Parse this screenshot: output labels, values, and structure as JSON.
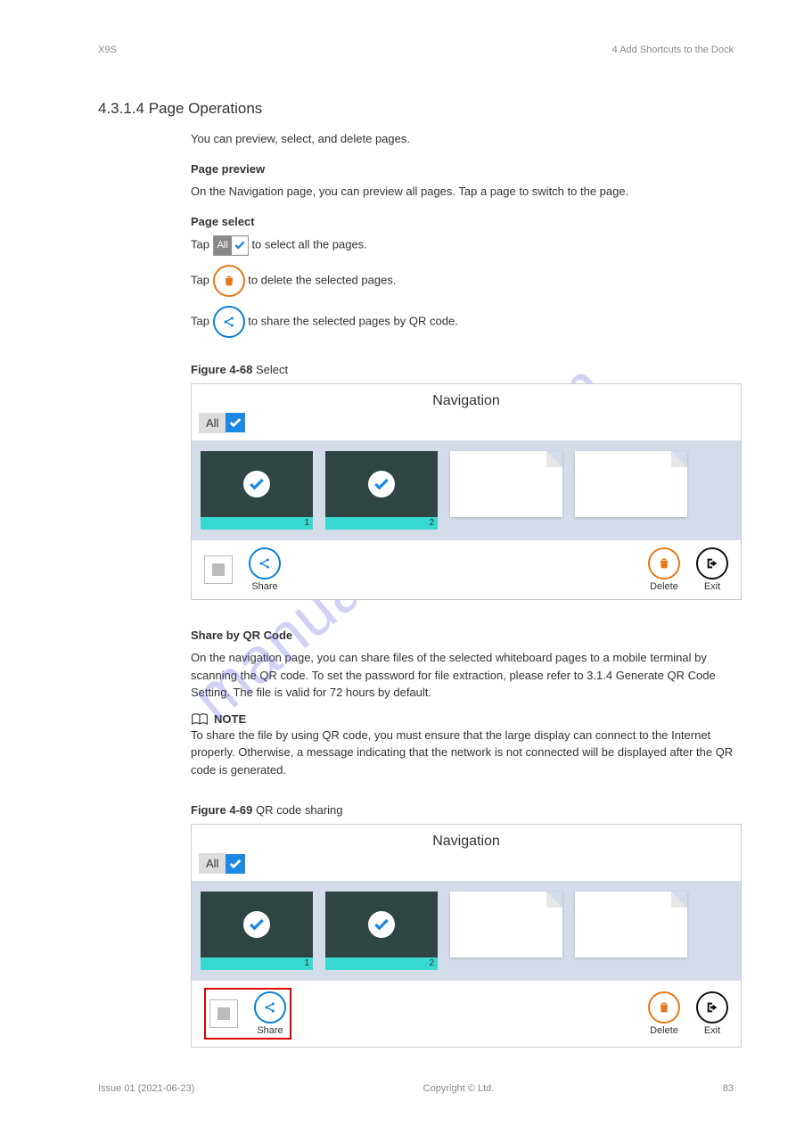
{
  "doc": {
    "product": "X9S",
    "chapter_ref": "4 Add Shortcuts to the Dock",
    "issue": "Issue 01 (2021-06-23)",
    "copyright": "Copyright ©  Ltd.",
    "page_no": "83"
  },
  "section": {
    "heading": "4.3.1.4 Page Operations",
    "intro": "You can preview, select, and delete pages.",
    "sub_preview": "Page preview",
    "preview_text": "On the Navigation page, you can preview all pages. Tap a page to switch to the page.",
    "sub_select": "Page select",
    "line_all": "to select all the pages.",
    "line_delete": "to delete the selected pages.",
    "line_share": "to share the selected pages by QR code.",
    "fig1_num": "Figure 4-68",
    "fig1_title": " Select",
    "sub_sharecode": "Share by QR Code",
    "sharecode_p1": "On the navigation page, you can share files of the selected whiteboard pages to a mobile terminal by scanning the QR code. To set the password for file extraction, please refer to 3.1.4 Generate QR Code Setting. The file is valid for 72 hours by default.",
    "note_label": "NOTE",
    "note_text": "To share the file by using QR code, you must ensure that the large display can connect to the Internet properly. Otherwise, a message indicating that the network is not connected will be displayed after the QR code is generated.",
    "fig2_num": "Figure 4-69",
    "fig2_title": " QR code sharing",
    "tap_prefix": "Tap "
  },
  "nav": {
    "title": "Navigation",
    "all": "All",
    "thumb1": "1",
    "thumb2": "2",
    "share": "Share",
    "delete": "Delete",
    "exit": "Exit"
  },
  "watermark": "manualshive.com"
}
